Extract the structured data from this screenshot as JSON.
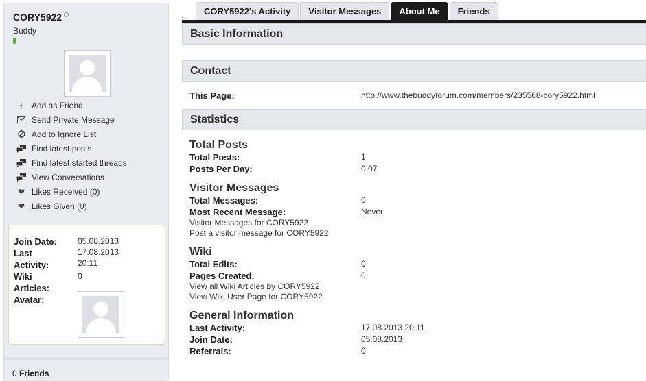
{
  "profile": {
    "username": "CORY5922",
    "usertitle": "Buddy",
    "colors": {
      "reputation": "#53b43a",
      "tab_active": "#1b1b1b"
    }
  },
  "actions": [
    {
      "icon": "plus-icon",
      "label": "Add as Friend"
    },
    {
      "icon": "envelope-icon",
      "label": "Send Private Message"
    },
    {
      "icon": "ignore-icon",
      "label": "Add to Ignore List"
    },
    {
      "icon": "posts-icon",
      "label": "Find latest posts"
    },
    {
      "icon": "threads-icon",
      "label": "Find latest started threads"
    },
    {
      "icon": "conversations-icon",
      "label": "View Conversations"
    },
    {
      "icon": "heart-icon",
      "label": "Likes Received (0)"
    },
    {
      "icon": "heart-icon",
      "label": "Likes Given (0)"
    }
  ],
  "mini_stats": {
    "join_date_label": "Join Date:",
    "join_date": "05.08.2013",
    "last_label_1": "Last",
    "last_label_2": "Activity:",
    "last_date": "17.08.2013",
    "last_time": "20:11",
    "wiki_label_1": "Wiki",
    "wiki_label_2": "Articles:",
    "wiki_value": "0",
    "avatar_label": "Avatar:"
  },
  "friends": {
    "count": "0",
    "label": "Friends"
  },
  "tabs": [
    {
      "label": "CORY5922's Activity",
      "active": false
    },
    {
      "label": "Visitor Messages",
      "active": false
    },
    {
      "label": "About Me",
      "active": true
    },
    {
      "label": "Friends",
      "active": false
    }
  ],
  "sections": {
    "basic": "Basic Information",
    "contact": "Contact",
    "statistics": "Statistics"
  },
  "contact": {
    "label": "This Page:",
    "value": "http://www.thebuddyforum.com/members/235568-cory5922.html"
  },
  "stats": {
    "total_posts_title": "Total Posts",
    "total_posts_label": "Total Posts:",
    "total_posts_value": "1",
    "ppd_label": "Posts Per Day:",
    "ppd_value": "0.07",
    "vm_title": "Visitor Messages",
    "vm_total_label": "Total Messages:",
    "vm_total_value": "0",
    "vm_recent_label": "Most Recent Message:",
    "vm_recent_value": "Never",
    "vm_link1": "Visitor Messages for CORY5922",
    "vm_link2": "Post a visitor message for CORY5922",
    "wiki_title": "Wiki",
    "wiki_edits_label": "Total Edits:",
    "wiki_edits_value": "0",
    "wiki_pages_label": "Pages Created:",
    "wiki_pages_value": "0",
    "wiki_link1": "View all Wiki Articles by CORY5922",
    "wiki_link2": "View Wiki User Page for CORY5922",
    "gen_title": "General Information",
    "gen_last_label": "Last Activity:",
    "gen_last_value": "17.08.2013 20:11",
    "gen_join_label": "Join Date:",
    "gen_join_value": "05.08.2013",
    "gen_ref_label": "Referrals:",
    "gen_ref_value": "0"
  }
}
